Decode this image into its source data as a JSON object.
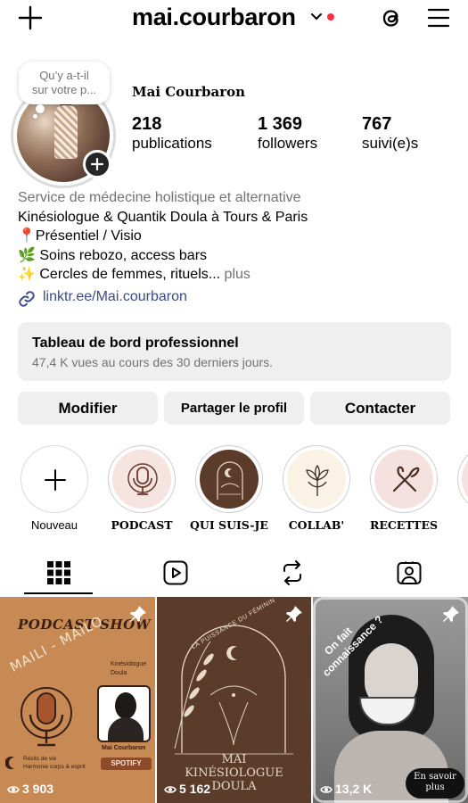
{
  "header": {
    "username": "mai.courbaron",
    "notification_dot_color": "#ff3040"
  },
  "profile": {
    "note": [
      "Qu’y a-t-il",
      "sur votre p..."
    ],
    "full_name": "Mai Courbaron",
    "stats": [
      {
        "value": "218",
        "label": "publications"
      },
      {
        "value": "1 369",
        "label": "followers"
      },
      {
        "value": "767",
        "label": "suivi(e)s"
      }
    ]
  },
  "bio": {
    "category": "Service de médecine holistique et alternative",
    "line1": "Kinésiologue & Quantik Doula à Tours & Paris",
    "line2": "📍Présentiel / Visio",
    "line3": "🌿 Soins rebozo, access bars",
    "line4": "✨ Cercles de femmes, rituels...",
    "more": "plus",
    "link": "linktr.ee/Mai.courbaron"
  },
  "dashboard": {
    "title": "Tableau de bord professionnel",
    "subtitle": "47,4 K vues au cours des 30 derniers jours."
  },
  "buttons": {
    "edit": "Modifier",
    "share": "Partager le profil",
    "contact": "Contacter"
  },
  "highlights": [
    {
      "label": "Nouveau",
      "icon": "plus-icon"
    },
    {
      "label": "PODCAST",
      "icon": "microphone-icon"
    },
    {
      "label": "QUI SUIS-JE",
      "icon": "moon-arch-icon"
    },
    {
      "label": "COLLAB'",
      "icon": "flower-icon"
    },
    {
      "label": "RECETTES",
      "icon": "whisk-icon"
    }
  ],
  "tabs": [
    {
      "name": "grid-tab",
      "icon": "grid-icon",
      "active": true
    },
    {
      "name": "reels-tab",
      "icon": "reels-icon"
    },
    {
      "name": "reposts-tab",
      "icon": "repost-icon"
    },
    {
      "name": "tagged-tab",
      "icon": "tagged-person-icon"
    }
  ],
  "posts": [
    {
      "title": "PODCAST SHOW",
      "show": "MAILI - MAILO",
      "tag": [
        "Kinésiologue",
        "Doula"
      ],
      "caption": "Mai Courbaron",
      "badge": "SPOTIFY",
      "footnote": [
        "Récits de vie",
        "Harmonie corps & esprit"
      ],
      "views": "3 903",
      "pinned": true,
      "bg_color": "#c88a55"
    },
    {
      "arc_text": "LA PUISSANCE DU FÉMININ",
      "name": "MAI",
      "subtitle": [
        "KINÉSIOLOGUE",
        "DOULA"
      ],
      "views": "5 162",
      "pinned": true,
      "bg_color": "#5b3b2a"
    },
    {
      "sticker": [
        "On fait",
        "connaissance ?"
      ],
      "bubble": [
        "En savoir",
        "plus"
      ],
      "views": "13,2 K",
      "pinned": true,
      "bg_color": "#7a7a7a"
    }
  ]
}
